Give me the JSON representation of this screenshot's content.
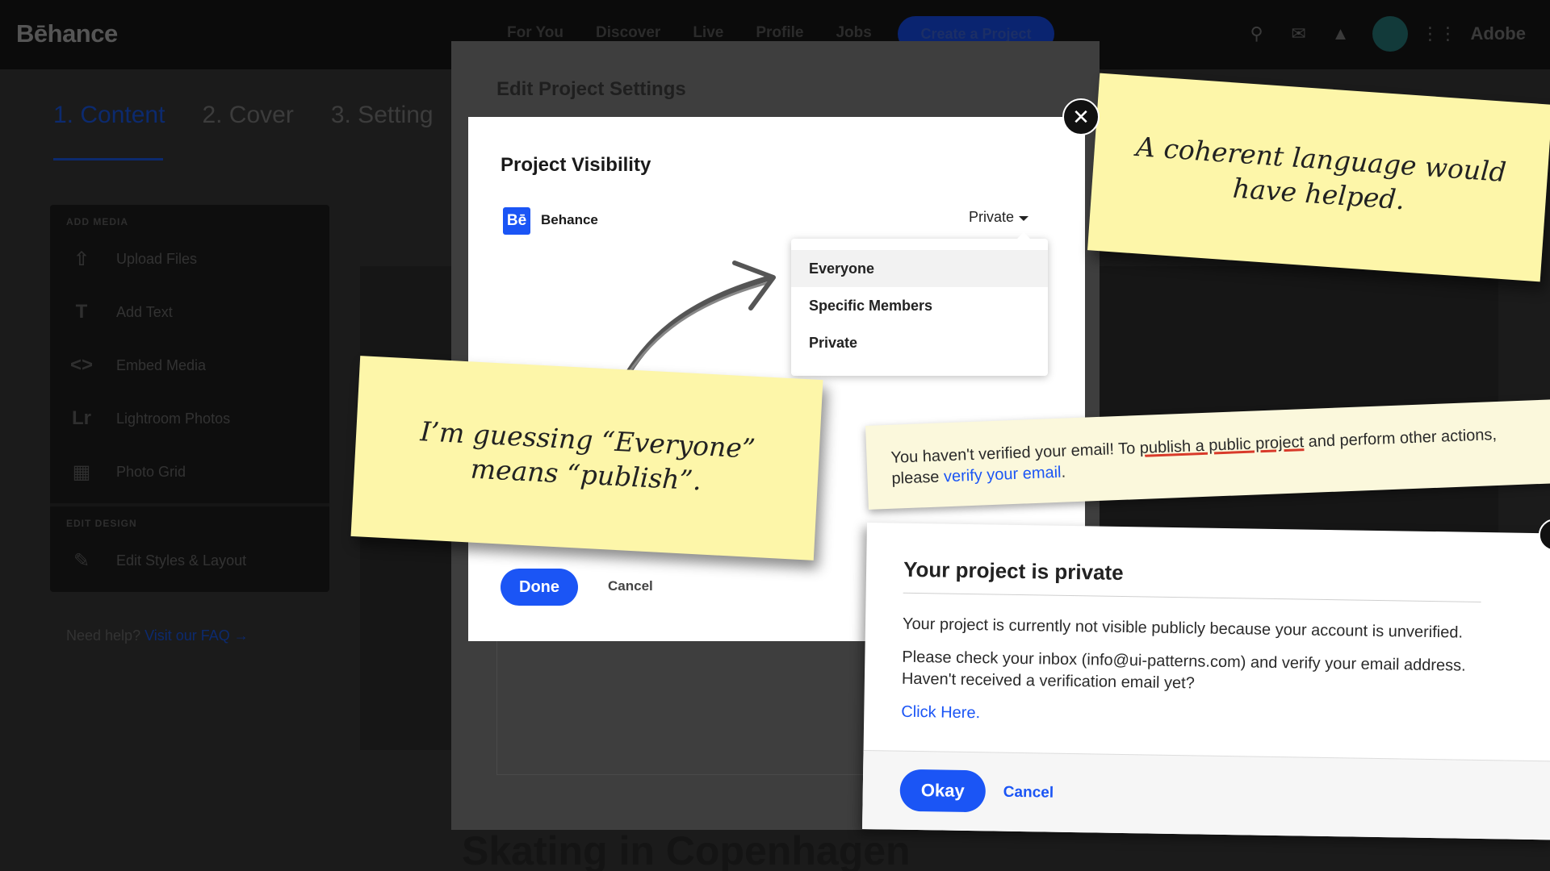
{
  "header": {
    "logo": "Bēhance",
    "nav": [
      "For You",
      "Discover",
      "Live",
      "Profile",
      "Jobs"
    ],
    "create_label": "Create a Project",
    "adobe_label": "Adobe"
  },
  "steps": [
    "1. Content",
    "2. Cover",
    "3. Setting"
  ],
  "sidebar": {
    "add_media_heading": "ADD MEDIA",
    "items": [
      {
        "icon": "upload-icon",
        "label": "Upload Files"
      },
      {
        "icon": "text-icon",
        "label": "Add Text"
      },
      {
        "icon": "embed-icon",
        "label": "Embed Media"
      },
      {
        "icon": "lightroom-icon",
        "label": "Lightroom Photos"
      },
      {
        "icon": "grid-icon",
        "label": "Photo Grid"
      }
    ],
    "edit_design_heading": "EDIT DESIGN",
    "edit_item": {
      "icon": "pencil-icon",
      "label": "Edit Styles & Layout"
    },
    "help_text": "Need help?",
    "help_link": "Visit our FAQ →"
  },
  "project_title": "Skating in Copenhagen",
  "settings_modal": {
    "title": "Edit Project Settings"
  },
  "visibility": {
    "title": "Project Visibility",
    "brand_mark": "Bē",
    "brand_name": "Behance",
    "selected": "Private",
    "options": [
      "Everyone",
      "Specific Members",
      "Private"
    ],
    "done_label": "Done",
    "cancel_label": "Cancel"
  },
  "stickies": {
    "note1": "A coherent language would have helped.",
    "note2": "I’m guessing “Everyone” means “publish”."
  },
  "warning": {
    "text_a": "You haven't verified your email! To ",
    "text_underlined": "publish a public project",
    "text_b": " and perform other actions, please ",
    "link": "verify your email",
    "text_c": "."
  },
  "private_dialog": {
    "title": "Your project is private",
    "line1": "Your project is currently not visible publicly because your account is unverified.",
    "line2": "Please check your inbox (info@ui-patterns.com) and verify your email address. Haven't received a verification email yet?",
    "link": "Click Here.",
    "okay_label": "Okay",
    "cancel_label": "Cancel"
  },
  "colors": {
    "accent": "#1b55f5",
    "sticky": "#fdf6a9",
    "underline": "#d83a2a"
  }
}
